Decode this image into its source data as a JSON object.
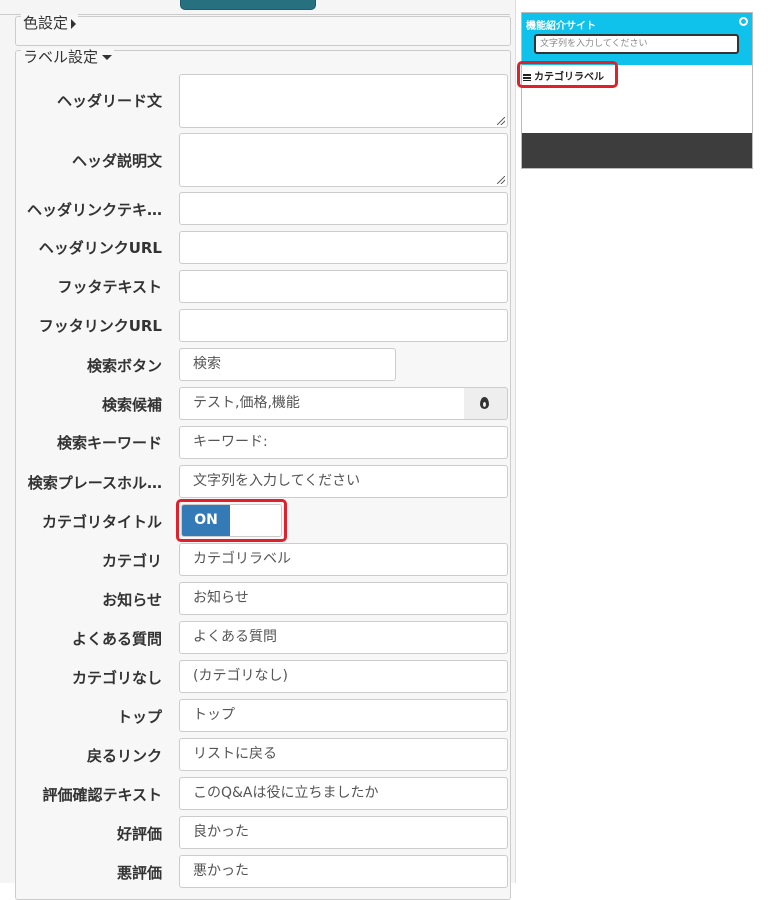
{
  "sections": {
    "color_settings": "色設定",
    "label_settings": "ラベル設定"
  },
  "fields": {
    "header_lead": {
      "label": "ヘッダリード文",
      "value": ""
    },
    "header_desc": {
      "label": "ヘッダ説明文",
      "value": ""
    },
    "header_link_text": {
      "label": "ヘッダリンクテキ…",
      "value": ""
    },
    "header_link_url": {
      "label": "ヘッダリンクURL",
      "value": ""
    },
    "footer_text": {
      "label": "フッタテキスト",
      "value": ""
    },
    "footer_link_url": {
      "label": "フッタリンクURL",
      "value": ""
    },
    "search_button": {
      "label": "検索ボタン",
      "value": "検索"
    },
    "search_candidates": {
      "label": "検索候補",
      "value": "テスト,価格,機能"
    },
    "search_keyword": {
      "label": "検索キーワード",
      "value": "キーワード:"
    },
    "search_placeholder": {
      "label": "検索プレースホル…",
      "value": "文字列を入力してください"
    },
    "category_title": {
      "label": "カテゴリタイトル",
      "toggle": "ON"
    },
    "category": {
      "label": "カテゴリ",
      "value": "カテゴリラベル"
    },
    "news": {
      "label": "お知らせ",
      "value": "お知らせ"
    },
    "faq": {
      "label": "よくある質問",
      "value": "よくある質問"
    },
    "no_category": {
      "label": "カテゴリなし",
      "value": "(カテゴリなし)"
    },
    "top": {
      "label": "トップ",
      "value": "トップ"
    },
    "back_link": {
      "label": "戻るリンク",
      "value": "リストに戻る"
    },
    "rating_confirm": {
      "label": "評価確認テキスト",
      "value": "このQ&Aは役に立ちましたか"
    },
    "good_rating": {
      "label": "好評価",
      "value": "良かった"
    },
    "bad_rating": {
      "label": "悪評価",
      "value": "悪かった"
    }
  },
  "preview": {
    "site_title": "機能紹介サイト",
    "search_placeholder": "文字列を入力してください",
    "category_label": "カテゴリラベル"
  },
  "colors": {
    "accent": "#337ab7",
    "preview_header": "#0ec2ec",
    "highlight": "#e0202a",
    "preview_footer": "#3d3d3d"
  }
}
